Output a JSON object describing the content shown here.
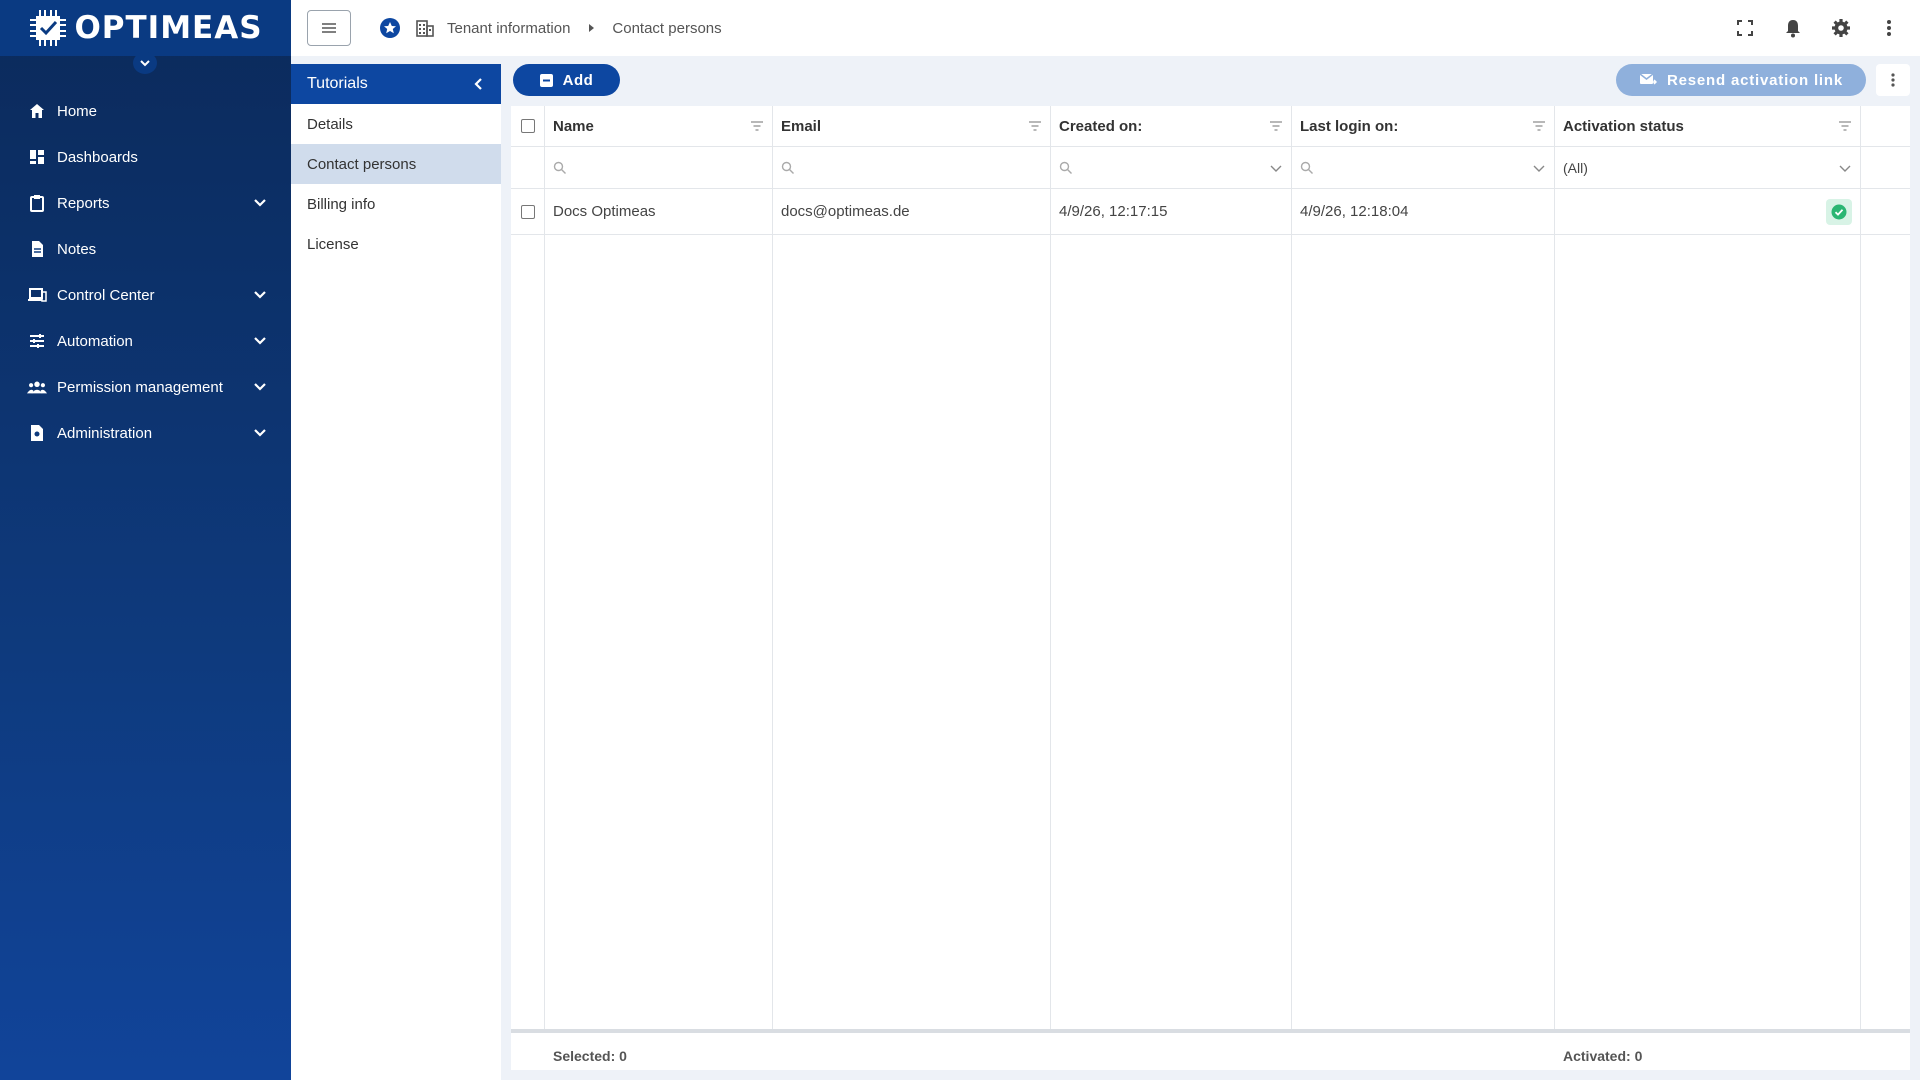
{
  "brand": {
    "name": "OPTIMEAS"
  },
  "sidebar": {
    "items": [
      {
        "label": "Home",
        "icon": "home-icon",
        "expandable": false
      },
      {
        "label": "Dashboards",
        "icon": "dashboard-icon",
        "expandable": false
      },
      {
        "label": "Reports",
        "icon": "clipboard-icon",
        "expandable": true
      },
      {
        "label": "Notes",
        "icon": "document-icon",
        "expandable": false
      },
      {
        "label": "Control Center",
        "icon": "devices-icon",
        "expandable": true
      },
      {
        "label": "Automation",
        "icon": "sliders-icon",
        "expandable": true
      },
      {
        "label": "Permission management",
        "icon": "people-icon",
        "expandable": true
      },
      {
        "label": "Administration",
        "icon": "admin-document-icon",
        "expandable": true
      }
    ]
  },
  "breadcrumb": {
    "parent": "Tenant information",
    "current": "Contact persons"
  },
  "subpanel": {
    "title": "Tutorials",
    "items": [
      "Details",
      "Contact persons",
      "Billing info",
      "License"
    ],
    "active_index": 1
  },
  "toolbar": {
    "add_label": "Add",
    "resend_label": "Resend activation link"
  },
  "grid": {
    "columns": [
      "Name",
      "Email",
      "Created on:",
      "Last login on:",
      "Activation status"
    ],
    "activation_filter": "(All)",
    "rows": [
      {
        "name": "Docs Optimeas",
        "email": "docs@optimeas.de",
        "created": "4/9/26, 12:17:15",
        "last_login": "4/9/26, 12:18:04",
        "activated": true
      }
    ],
    "footer": {
      "selected": "Selected: 0",
      "activated": "Activated: 0"
    }
  },
  "colors": {
    "primary": "#0d47a1",
    "sidebar": "#0b2a5b",
    "success": "#2bb673",
    "resend_disabled": "#8fb0dc"
  }
}
